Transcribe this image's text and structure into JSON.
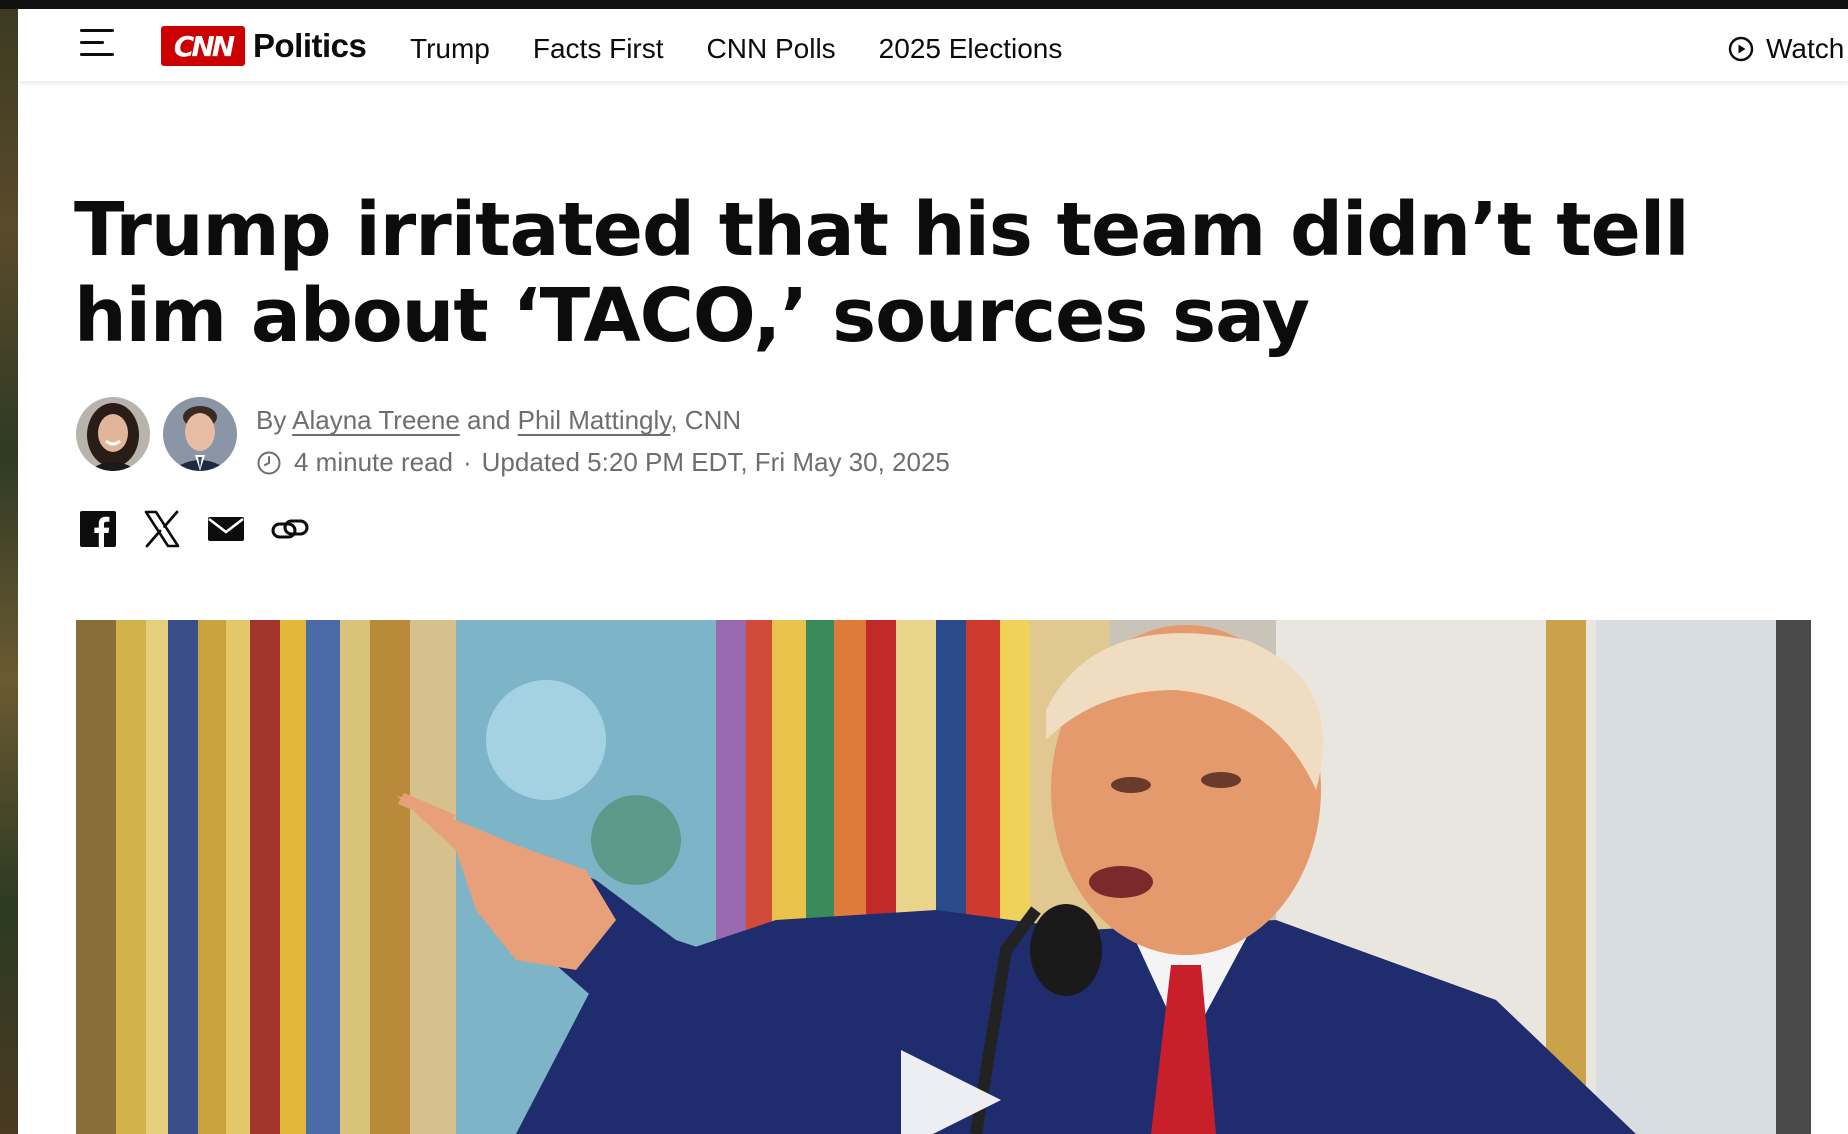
{
  "header": {
    "menu_icon": "hamburger-menu-icon",
    "logo_text": "CNN",
    "section": "Politics",
    "nav_items": [
      "Trump",
      "Facts First",
      "CNN Polls",
      "2025 Elections"
    ],
    "watch_label": "Watch",
    "watch_icon": "play-circle-icon"
  },
  "article": {
    "headline": "Trump irritated that his team didn’t tell him about ‘TACO,’ sources say",
    "byline": {
      "prefix": "By",
      "author1": "Alayna Treene",
      "conjunction": "and",
      "author2": "Phil Mattingly",
      "outlet": ", CNN"
    },
    "read_time": "4 minute read",
    "separator": "·",
    "updated": "Updated 5:20 PM EDT, Fri May 30, 2025",
    "share_icons": [
      "facebook-icon",
      "x-icon",
      "email-icon",
      "copy-link-icon"
    ]
  },
  "colors": {
    "brand_red": "#cc0000",
    "text": "#0c0c0c",
    "muted": "#6e6e6e"
  }
}
